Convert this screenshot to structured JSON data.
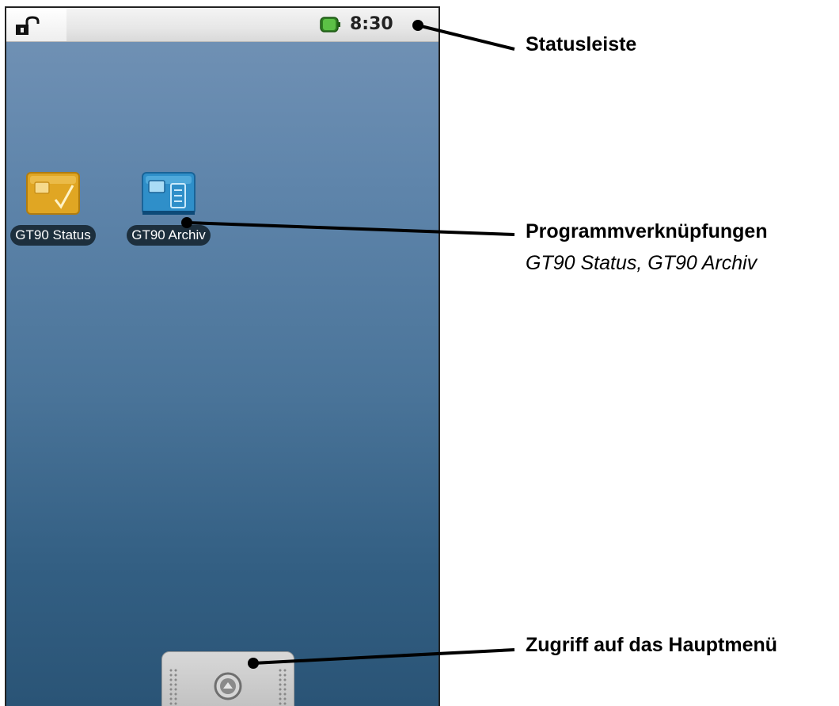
{
  "statusbar": {
    "time": "8:30",
    "lock_icon": "unlocked-padlock-icon",
    "battery_icon": "battery-icon",
    "battery_color": "#3c9a2e"
  },
  "shortcuts": [
    {
      "label": "GT90 Status",
      "icon": "sim-check-icon",
      "color": "#e0a623"
    },
    {
      "label": "GT90 Archiv",
      "icon": "sim-archive-icon",
      "color": "#2f8fc9"
    }
  ],
  "launcher": {
    "icon": "arrow-up-icon"
  },
  "callouts": {
    "statusbar": "Statusleiste",
    "shortcuts_title": "Programmverknüpfungen",
    "shortcuts_subtitle": "GT90 Status, GT90 Archiv",
    "main_menu": "Zugriff auf das Hauptmenü"
  },
  "colors": {
    "wallpaper_top": "#7393b6",
    "wallpaper_bottom": "#2a5476",
    "label_background": "#1d2f3d"
  }
}
